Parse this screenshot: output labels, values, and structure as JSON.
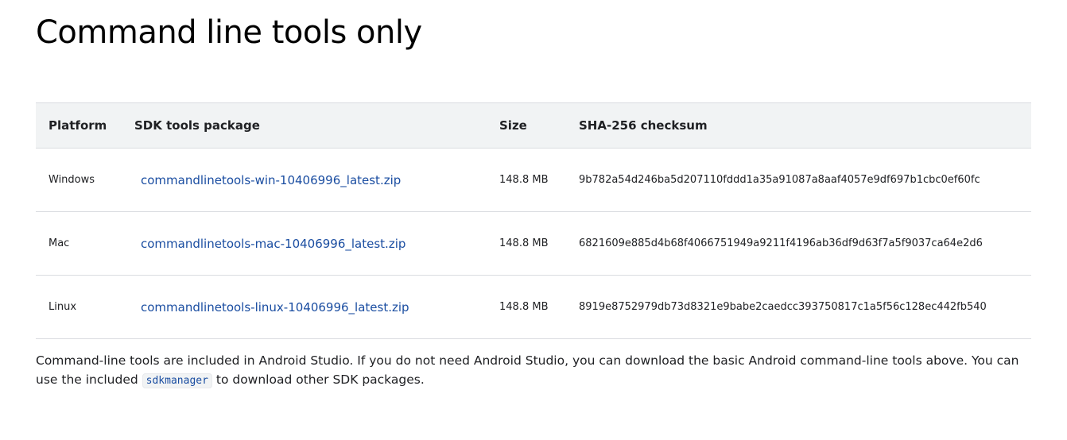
{
  "page": {
    "title": "Command line tools only"
  },
  "table": {
    "headers": {
      "platform": "Platform",
      "package": "SDK tools package",
      "size": "Size",
      "checksum": "SHA-256 checksum"
    },
    "rows": [
      {
        "platform": "Windows",
        "package": "commandlinetools-win-10406996_latest.zip",
        "size": "148.8 MB",
        "checksum": "9b782a54d246ba5d207110fddd1a35a91087a8aaf4057e9df697b1cbc0ef60fc"
      },
      {
        "platform": "Mac",
        "package": "commandlinetools-mac-10406996_latest.zip",
        "size": "148.8 MB",
        "checksum": "6821609e885d4b68f4066751949a9211f4196ab36df9d63f7a5f9037ca64e2d6"
      },
      {
        "platform": "Linux",
        "package": "commandlinetools-linux-10406996_latest.zip",
        "size": "148.8 MB",
        "checksum": "8919e8752979db73d8321e9babe2caedcc393750817c1a5f56c128ec442fb540"
      }
    ]
  },
  "note": {
    "text_before": "Command-line tools are included in Android Studio. If you do not need Android Studio, you can download the basic Android command-line tools above. You can use the included ",
    "code": "sdkmanager",
    "text_after": " to download other SDK packages."
  },
  "colors": {
    "link": "#1a4da1",
    "header_bg": "#f1f3f4",
    "border": "#dadce0",
    "text": "#202124"
  }
}
